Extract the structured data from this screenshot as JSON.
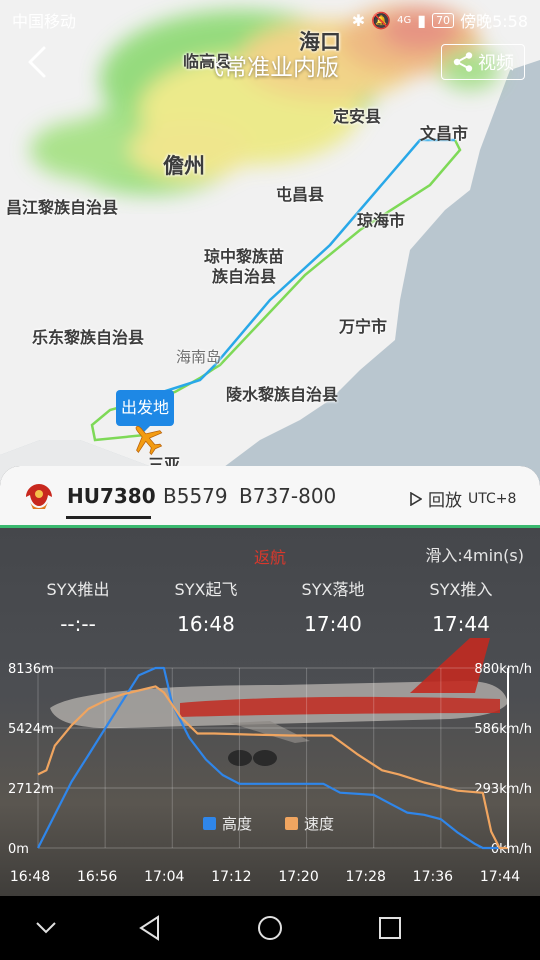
{
  "status_bar": {
    "carrier": "中国移动",
    "signal_text": "4G",
    "battery": "70",
    "clock": "傍晚5:58"
  },
  "top_bar": {
    "title": "飞常准业内版",
    "video_label": "视频"
  },
  "map": {
    "labels": {
      "haikou": "海口",
      "lingao": "临高县",
      "dingan": "定安县",
      "wenchang": "文昌市",
      "danzhou": "儋州",
      "tunchang": "屯昌县",
      "changjiang": "昌江黎族自治县",
      "qionghai": "琼海市",
      "qiongzhong": "琼中黎族苗族自治县",
      "wanning": "万宁市",
      "ledong": "乐东黎族自治县",
      "hainan_island": "海南岛",
      "lingshui": "陵水黎族自治县",
      "sanya": "三亚"
    },
    "origin_badge": "出发地",
    "weather_colors": [
      "#7fd36a",
      "#e9e77a",
      "#f3c76a",
      "#e88a6a"
    ],
    "track_colors": {
      "outbound": "#7ed957",
      "return": "#29a8e8"
    }
  },
  "flight": {
    "flight_number": "HU7380",
    "registration": "B5579",
    "aircraft_type": "B737-800",
    "replay_label": "回放",
    "timezone": "UTC+8",
    "progress": 1.0,
    "status": "返航",
    "taxi_in": "滑入:4min(s)",
    "times": [
      {
        "label": "SYX推出",
        "value": "--:--"
      },
      {
        "label": "SYX起飞",
        "value": "16:48"
      },
      {
        "label": "SYX落地",
        "value": "17:40"
      },
      {
        "label": "SYX推入",
        "value": "17:44"
      }
    ]
  },
  "legend": {
    "altitude": "高度",
    "speed": "速度"
  },
  "chart_data": {
    "type": "line",
    "x_ticks": [
      "16:48",
      "16:56",
      "17:04",
      "17:12",
      "17:20",
      "17:28",
      "17:36",
      "17:44"
    ],
    "y_left_ticks": [
      "8136m",
      "5424m",
      "2712m",
      "0m"
    ],
    "y_right_ticks": [
      "880km/h",
      "586km/h",
      "293km/h",
      "0km/h"
    ],
    "ylim_left": [
      0,
      8136
    ],
    "ylim_right": [
      0,
      880
    ],
    "xlim_minutes": [
      0,
      56
    ],
    "series": [
      {
        "name": "高度",
        "color": "#2f86ea",
        "axis": "left",
        "points": [
          [
            0,
            0
          ],
          [
            2,
            1500
          ],
          [
            4,
            3000
          ],
          [
            6,
            4200
          ],
          [
            8,
            5400
          ],
          [
            10,
            6600
          ],
          [
            12,
            7800
          ],
          [
            14,
            8136
          ],
          [
            15,
            8136
          ],
          [
            16,
            6500
          ],
          [
            18,
            5000
          ],
          [
            20,
            4000
          ],
          [
            22,
            3300
          ],
          [
            24,
            2900
          ],
          [
            26,
            2900
          ],
          [
            30,
            2900
          ],
          [
            34,
            2900
          ],
          [
            36,
            2500
          ],
          [
            40,
            2400
          ],
          [
            42,
            2000
          ],
          [
            44,
            1600
          ],
          [
            46,
            1500
          ],
          [
            48,
            1300
          ],
          [
            50,
            700
          ],
          [
            52,
            200
          ],
          [
            53,
            0
          ],
          [
            56,
            0
          ]
        ]
      },
      {
        "name": "速度",
        "color": "#f0a560",
        "axis": "right",
        "points": [
          [
            0,
            360
          ],
          [
            1,
            380
          ],
          [
            2,
            500
          ],
          [
            4,
            600
          ],
          [
            6,
            680
          ],
          [
            8,
            720
          ],
          [
            10,
            750
          ],
          [
            12,
            770
          ],
          [
            14,
            790
          ],
          [
            15,
            760
          ],
          [
            17,
            640
          ],
          [
            19,
            560
          ],
          [
            21,
            560
          ],
          [
            25,
            555
          ],
          [
            30,
            550
          ],
          [
            35,
            550
          ],
          [
            38,
            460
          ],
          [
            41,
            380
          ],
          [
            43,
            360
          ],
          [
            46,
            320
          ],
          [
            50,
            280
          ],
          [
            53,
            270
          ],
          [
            54,
            80
          ],
          [
            55,
            0
          ],
          [
            56,
            0
          ]
        ]
      }
    ],
    "legend_position": "center",
    "grid": true
  }
}
